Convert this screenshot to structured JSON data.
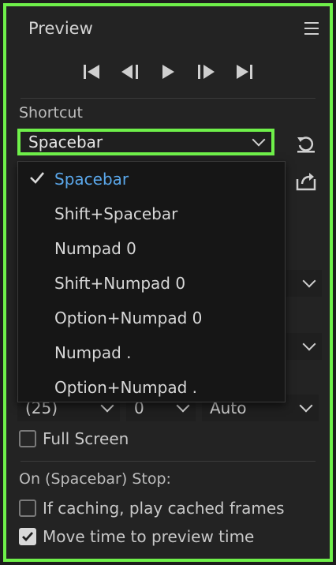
{
  "panel": {
    "title": "Preview",
    "menu_icon": "hamburger-menu-icon"
  },
  "transport": [
    {
      "name": "first-frame-button",
      "icon": "skip-to-start-icon"
    },
    {
      "name": "step-back-button",
      "icon": "step-back-icon"
    },
    {
      "name": "play-button",
      "icon": "play-icon"
    },
    {
      "name": "step-forward-button",
      "icon": "step-forward-icon"
    },
    {
      "name": "last-frame-button",
      "icon": "skip-to-end-icon"
    }
  ],
  "shortcut": {
    "label": "Shortcut",
    "selected": "Spacebar",
    "options": [
      "Spacebar",
      "Shift+Spacebar",
      "Numpad 0",
      "Shift+Numpad 0",
      "Option+Numpad 0",
      "Numpad .",
      "Option+Numpad ."
    ]
  },
  "resolution": {
    "frame_rate": "(25)",
    "skip": "0",
    "resolution": "Auto"
  },
  "full_screen": {
    "label": "Full Screen",
    "checked": false
  },
  "on_stop": {
    "label": "On (Spacebar) Stop:",
    "cache": {
      "label": "If caching, play cached frames",
      "checked": false
    },
    "move_time": {
      "label": "Move time to preview time",
      "checked": true
    }
  },
  "colors": {
    "accent": "#6ff04a",
    "selected_text": "#5aa7ea"
  }
}
